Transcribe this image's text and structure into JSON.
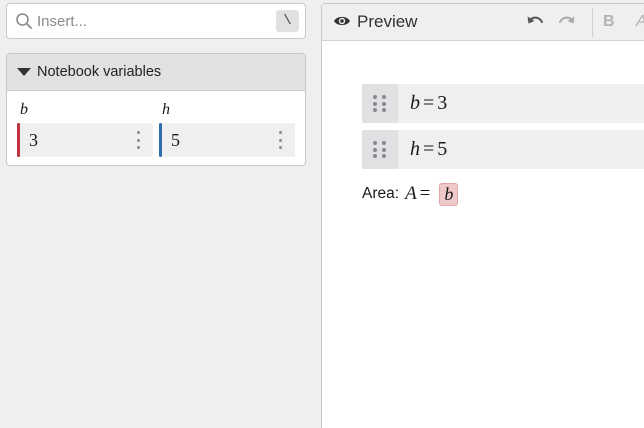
{
  "search": {
    "placeholder": "Insert...",
    "shortcut": "\\"
  },
  "variables_panel": {
    "title": "Notebook variables",
    "items": [
      {
        "name": "b",
        "value": "3",
        "color": "#c0323f"
      },
      {
        "name": "h",
        "value": "5",
        "color": "#2f6fb0"
      }
    ]
  },
  "preview": {
    "title": "Preview",
    "toolbar": {
      "bold": "B",
      "italic": "A"
    },
    "equations": [
      {
        "lhs": "b",
        "op": "=",
        "rhs": "3"
      },
      {
        "lhs": "h",
        "op": "=",
        "rhs": "5"
      }
    ],
    "area": {
      "label": "Area:",
      "lhs": "A",
      "op": "=",
      "chip": "b",
      "chip_color": "#efc8c9"
    }
  },
  "icons": [
    "search-icon",
    "caret-down-icon",
    "kebab-icon",
    "eye-icon",
    "undo-icon",
    "redo-icon",
    "drag-handle-icon"
  ]
}
